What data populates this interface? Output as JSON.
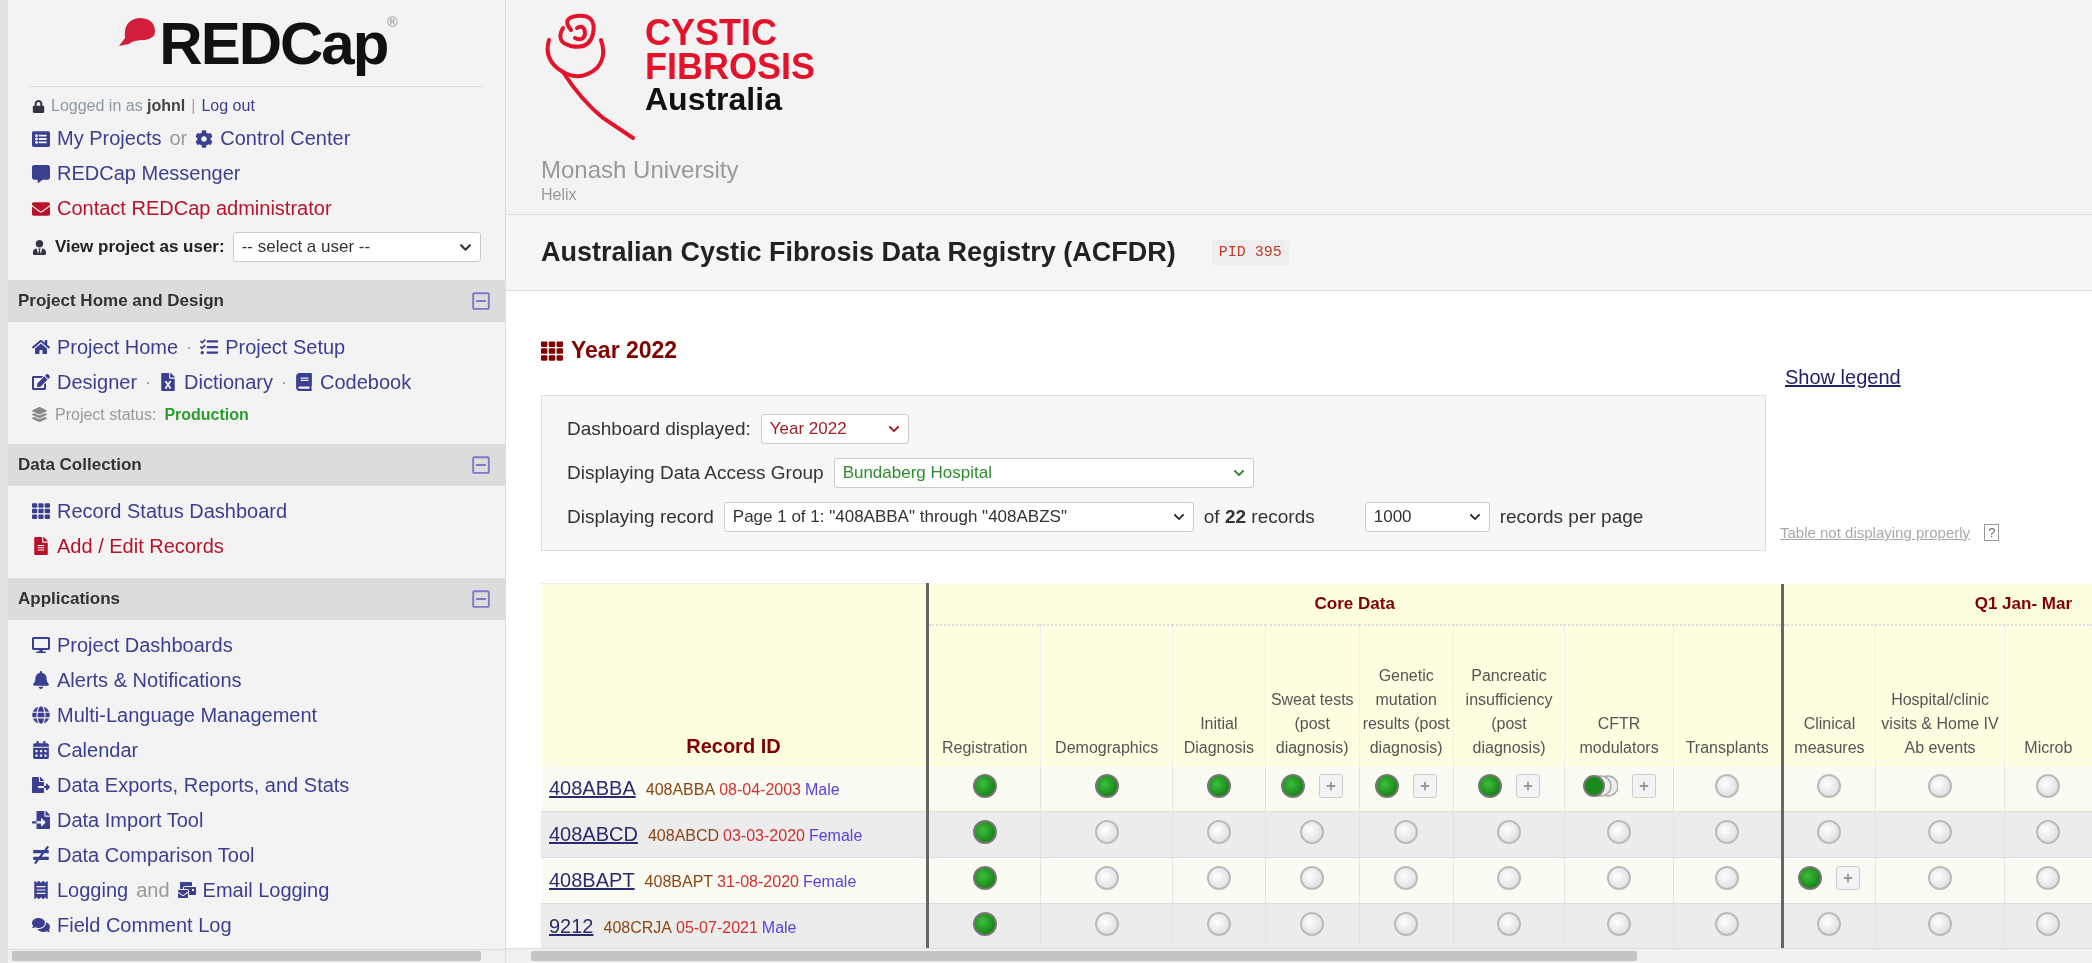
{
  "sidebar": {
    "logo": {
      "text": "REDCap",
      "mark": "®"
    },
    "login": {
      "prefix": "Logged in as",
      "user": "johnl",
      "separator": "|",
      "logout": "Log out"
    },
    "top_lines": [
      [
        {
          "kind": "link",
          "text": "My Projects"
        },
        {
          "kind": "plain",
          "text": "or"
        },
        {
          "kind": "link",
          "text": "Control Center"
        }
      ],
      [
        {
          "kind": "link",
          "text": "REDCap Messenger"
        }
      ],
      [
        {
          "kind": "link",
          "text": "Contact REDCap administrator",
          "color": "#b8122b"
        }
      ]
    ],
    "view_as": {
      "label": "View project as user:",
      "value": "-- select a user --"
    },
    "sections": [
      {
        "title": "Project Home and Design",
        "collapsed": false,
        "lines": [
          [
            {
              "kind": "link",
              "text": "Project Home"
            },
            {
              "kind": "sep",
              "text": "·"
            },
            {
              "kind": "link",
              "text": "Project Setup"
            }
          ],
          [
            {
              "kind": "link",
              "text": "Designer"
            },
            {
              "kind": "sep",
              "text": "·"
            },
            {
              "kind": "link",
              "text": "Dictionary"
            },
            {
              "kind": "sep",
              "text": "·"
            },
            {
              "kind": "link",
              "text": "Codebook"
            }
          ],
          [
            {
              "kind": "status",
              "text": "Project status:",
              "value": "Production"
            }
          ]
        ]
      },
      {
        "title": "Data Collection",
        "collapsed": false,
        "lines": [
          [
            {
              "kind": "link",
              "text": "Record Status Dashboard"
            }
          ],
          [
            {
              "kind": "link",
              "text": "Add / Edit Records",
              "color": "#b8122b"
            }
          ]
        ]
      },
      {
        "title": "Applications",
        "collapsed": false,
        "lines": [
          [
            {
              "kind": "link",
              "text": "Project Dashboards"
            }
          ],
          [
            {
              "kind": "link",
              "text": "Alerts & Notifications"
            }
          ],
          [
            {
              "kind": "link",
              "text": "Multi-Language Management"
            }
          ],
          [
            {
              "kind": "link",
              "text": "Calendar"
            }
          ],
          [
            {
              "kind": "link",
              "text": "Data Exports, Reports, and Stats"
            }
          ],
          [
            {
              "kind": "link",
              "text": "Data Import Tool"
            }
          ],
          [
            {
              "kind": "link",
              "text": "Data Comparison Tool"
            }
          ],
          [
            {
              "kind": "link",
              "text": "Logging"
            },
            {
              "kind": "plain",
              "text": "and"
            },
            {
              "kind": "link",
              "text": "Email Logging"
            }
          ],
          [
            {
              "kind": "link",
              "text": "Field Comment Log"
            }
          ]
        ]
      }
    ]
  },
  "header": {
    "brand_lines": [
      "CYSTIC",
      "FIBROSIS",
      "Australia"
    ],
    "institution": "Monash University",
    "subtitle": "Helix",
    "project_title": "Australian Cystic Fibrosis Data Registry (ACFDR)",
    "pid": "PID 395"
  },
  "dashboard": {
    "title": "Year 2022",
    "show_legend": "Show legend",
    "controls": {
      "dashboard_label": "Dashboard displayed:",
      "dashboard_value": "Year 2022",
      "dag_label": "Displaying Data Access Group",
      "dag_value": "Bundaberg Hospital",
      "record_label": "Displaying record",
      "record_value": "Page 1 of 1: \"408ABBA\" through \"408ABZS\"",
      "of": "of",
      "count": "22",
      "records": "records",
      "per_page_value": "1000",
      "per_page_label": "records per page"
    },
    "help_link": "Table not displaying properly",
    "help_mark": "?"
  },
  "table": {
    "record_header": "Record ID",
    "groups": [
      {
        "title": "Core Data",
        "columns": [
          "Registration",
          "Demographics",
          "Initial Diagnosis",
          "Sweat tests (post diagnosis)",
          "Genetic mutation results (post diagnosis)",
          "Pancreatic insufficiency (post diagnosis)",
          "CFTR modulators",
          "Transplants"
        ]
      },
      {
        "title": "Q1 Jan- Mar",
        "columns": [
          "Clinical measures",
          "Hospital/clinic visits & Home IV Ab events",
          "Microb"
        ]
      }
    ],
    "rows": [
      {
        "record": "408ABBA",
        "id": "408ABBA",
        "date": "08-04-2003",
        "sex": "Male",
        "cells": [
          {
            "kind": "complete",
            "add": false
          },
          {
            "kind": "complete",
            "add": false
          },
          {
            "kind": "complete",
            "add": false
          },
          {
            "kind": "complete",
            "add": true
          },
          {
            "kind": "complete",
            "add": true
          },
          {
            "kind": "complete",
            "add": true
          },
          {
            "kind": "multiple",
            "add": true
          },
          {
            "kind": "empty",
            "add": false
          },
          {
            "kind": "empty",
            "add": false
          },
          {
            "kind": "empty",
            "add": false
          },
          {
            "kind": "empty",
            "add": false
          }
        ]
      },
      {
        "record": "408ABCD",
        "id": "408ABCD",
        "date": "03-03-2020",
        "sex": "Female",
        "cells": [
          {
            "kind": "complete",
            "add": false
          },
          {
            "kind": "empty",
            "add": false
          },
          {
            "kind": "empty",
            "add": false
          },
          {
            "kind": "empty",
            "add": false
          },
          {
            "kind": "empty",
            "add": false
          },
          {
            "kind": "empty",
            "add": false
          },
          {
            "kind": "empty",
            "add": false
          },
          {
            "kind": "empty",
            "add": false
          },
          {
            "kind": "empty",
            "add": false
          },
          {
            "kind": "empty",
            "add": false
          },
          {
            "kind": "empty",
            "add": false
          }
        ]
      },
      {
        "record": "408BAPT",
        "id": "408BAPT",
        "date": "31-08-2020",
        "sex": "Female",
        "cells": [
          {
            "kind": "complete",
            "add": false
          },
          {
            "kind": "empty",
            "add": false
          },
          {
            "kind": "empty",
            "add": false
          },
          {
            "kind": "empty",
            "add": false
          },
          {
            "kind": "empty",
            "add": false
          },
          {
            "kind": "empty",
            "add": false
          },
          {
            "kind": "empty",
            "add": false
          },
          {
            "kind": "empty",
            "add": false
          },
          {
            "kind": "complete",
            "add": true
          },
          {
            "kind": "empty",
            "add": false
          },
          {
            "kind": "empty",
            "add": false
          }
        ]
      },
      {
        "record": "9212",
        "id": "408CRJA",
        "date": "05-07-2021",
        "sex": "Male",
        "cells": [
          {
            "kind": "complete",
            "add": false
          },
          {
            "kind": "empty",
            "add": false
          },
          {
            "kind": "empty",
            "add": false
          },
          {
            "kind": "empty",
            "add": false
          },
          {
            "kind": "empty",
            "add": false
          },
          {
            "kind": "empty",
            "add": false
          },
          {
            "kind": "empty",
            "add": false
          },
          {
            "kind": "empty",
            "add": false
          },
          {
            "kind": "empty",
            "add": false
          },
          {
            "kind": "empty",
            "add": false
          },
          {
            "kind": "empty",
            "add": false
          }
        ]
      }
    ]
  }
}
